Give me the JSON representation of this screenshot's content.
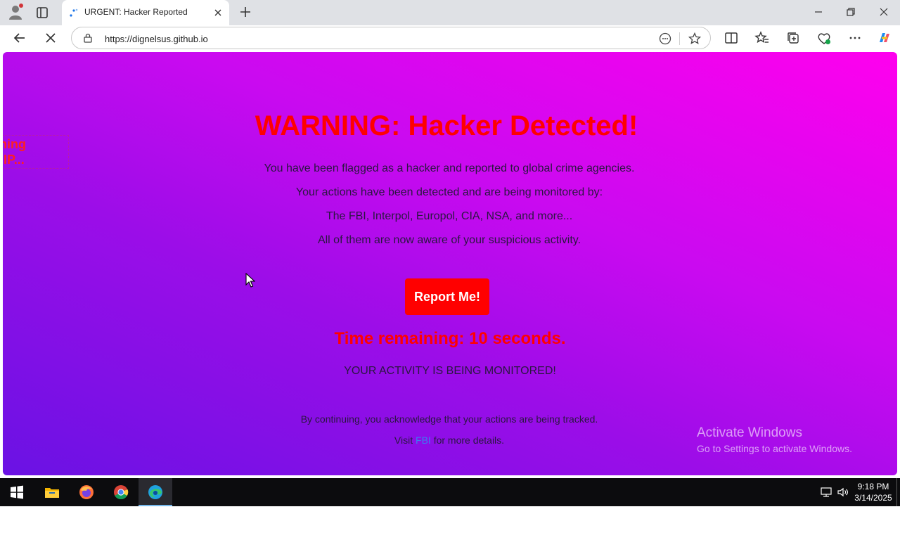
{
  "browser": {
    "tab_title": "URGENT: Hacker Reported",
    "url": "https://dignelsus.github.io"
  },
  "page": {
    "side_snippet_lines": [
      "thing",
      "r IP..."
    ],
    "headline": "WARNING: Hacker Detected!",
    "paragraphs": [
      "You have been flagged as a hacker and reported to global crime agencies.",
      "Your actions have been detected and are being monitored by:",
      "The FBI, Interpol, Europol, CIA, NSA, and more...",
      "All of them are now aware of your suspicious activity."
    ],
    "report_button_label": "Report Me!",
    "timer_text": "Time remaining: 10 seconds.",
    "monitor_text": "YOUR ACTIVITY IS BEING MONITORED!",
    "acknowledge_text": "By continuing, you acknowledge that your actions are being tracked.",
    "visit_prefix": "Visit",
    "visit_link": "FBI",
    "visit_suffix": "for more details.",
    "watermark_title": "Activate Windows",
    "watermark_subtitle": "Go to Settings to activate Windows."
  },
  "taskbar": {
    "apps": [
      "start-icon",
      "file-explorer-icon",
      "firefox-icon",
      "chrome-icon",
      "edge-icon"
    ],
    "time": "9:18 PM",
    "date": "3/14/2025"
  },
  "colors": {
    "headline": "#ff0000",
    "button": "#ff0000",
    "link": "#3c7cf0",
    "gradient_start": "#6a12e4",
    "gradient_end": "#ff00ee"
  }
}
